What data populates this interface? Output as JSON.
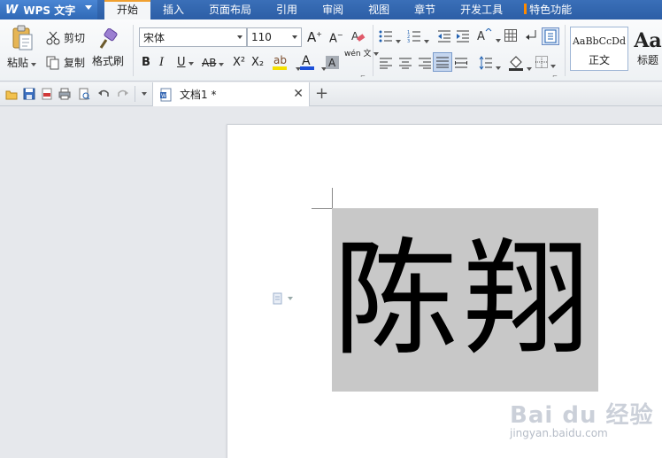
{
  "app": {
    "name": "WPS 文字"
  },
  "menu": {
    "tabs": [
      "开始",
      "插入",
      "页面布局",
      "引用",
      "审阅",
      "视图",
      "章节",
      "开发工具",
      "特色功能"
    ],
    "active_tab": "开始"
  },
  "ribbon": {
    "clipboard": {
      "paste": "粘贴",
      "cut": "剪切",
      "copy": "复制",
      "format_painter": "格式刷"
    },
    "font": {
      "name": "宋体",
      "size": "110",
      "bold": "B",
      "italic": "I",
      "underline": "U",
      "strikethrough": "AB",
      "superscript": "X²",
      "subscript": "X₂",
      "phonetic": "wén 文"
    },
    "styles": {
      "normal_preview": "AaBbCcDd",
      "normal_label": "正文",
      "heading_preview": "Aa",
      "heading_label": "标题"
    }
  },
  "document": {
    "tab_name": "文档1 *",
    "content": "陈翔"
  },
  "watermark": {
    "main": "Bai du 经验",
    "sub": "jingyan.baidu.com"
  },
  "colors": {
    "menubar": "#2c5ea6",
    "active_tab_accent": "#f0a030",
    "highlight": "#c8c8c8",
    "font_color_bar": "#1c4fd8",
    "highlight_color_bar": "#f5e000"
  }
}
